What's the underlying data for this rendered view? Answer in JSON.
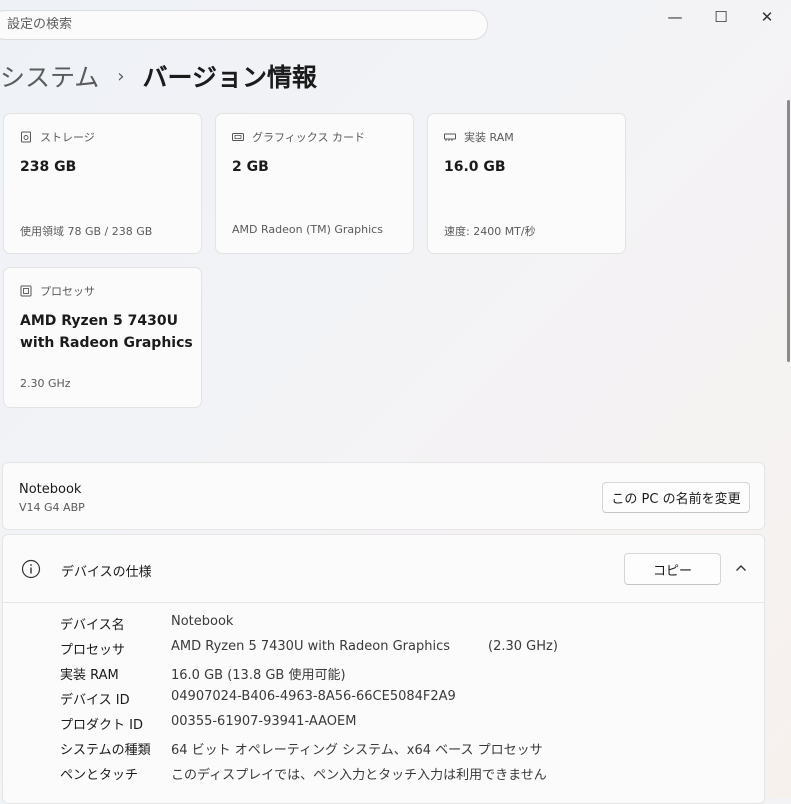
{
  "search": {
    "placeholder": "設定の検索"
  },
  "window": {
    "minimize_glyph": "—",
    "maximize_glyph": "☐",
    "close_glyph": "✕"
  },
  "breadcrumb": {
    "parent": "システム",
    "separator": "›",
    "current": "バージョン情報"
  },
  "cards": [
    {
      "icon": "storage-icon",
      "title": "ストレージ",
      "value": "238 GB",
      "sub": "使用領域 78 GB / 238 GB"
    },
    {
      "icon": "gpu-icon",
      "title": "グラフィックス カード",
      "value": "2 GB",
      "sub": "AMD Radeon (TM) Graphics"
    },
    {
      "icon": "ram-icon",
      "title": "実装 RAM",
      "value": "16.0 GB",
      "sub": "速度: 2400 MT/秒"
    },
    {
      "icon": "cpu-icon",
      "title": "プロセッサ",
      "value_line1": "AMD Ryzen 5 7430U",
      "value_line2": "with Radeon Graphics",
      "sub": "2.30 GHz"
    }
  ],
  "device": {
    "name": "Notebook",
    "model": "V14 G4 ABP",
    "rename_label": "この PC の名前を変更"
  },
  "specs": {
    "title": "デバイスの仕様",
    "copy_label": "コピー",
    "rows": [
      {
        "label": "デバイス名",
        "value": "Notebook"
      },
      {
        "label": "プロセッサ",
        "value": "AMD Ryzen 5 7430U with Radeon Graphics",
        "extra": "(2.30 GHz)"
      },
      {
        "label": "実装 RAM",
        "value": "16.0 GB (13.8 GB 使用可能)"
      },
      {
        "label": "デバイス ID",
        "value": "04907024-B406-4963-8A56-66CE5084F2A9"
      },
      {
        "label": "プロダクト ID",
        "value": "00355-61907-93941-AAOEM"
      },
      {
        "label": "システムの種類",
        "value": "64 ビット オペレーティング システム、x64 ベース プロセッサ"
      },
      {
        "label": "ペンとタッチ",
        "value": "このディスプレイでは、ペン入力とタッチ入力は利用できません"
      }
    ]
  }
}
